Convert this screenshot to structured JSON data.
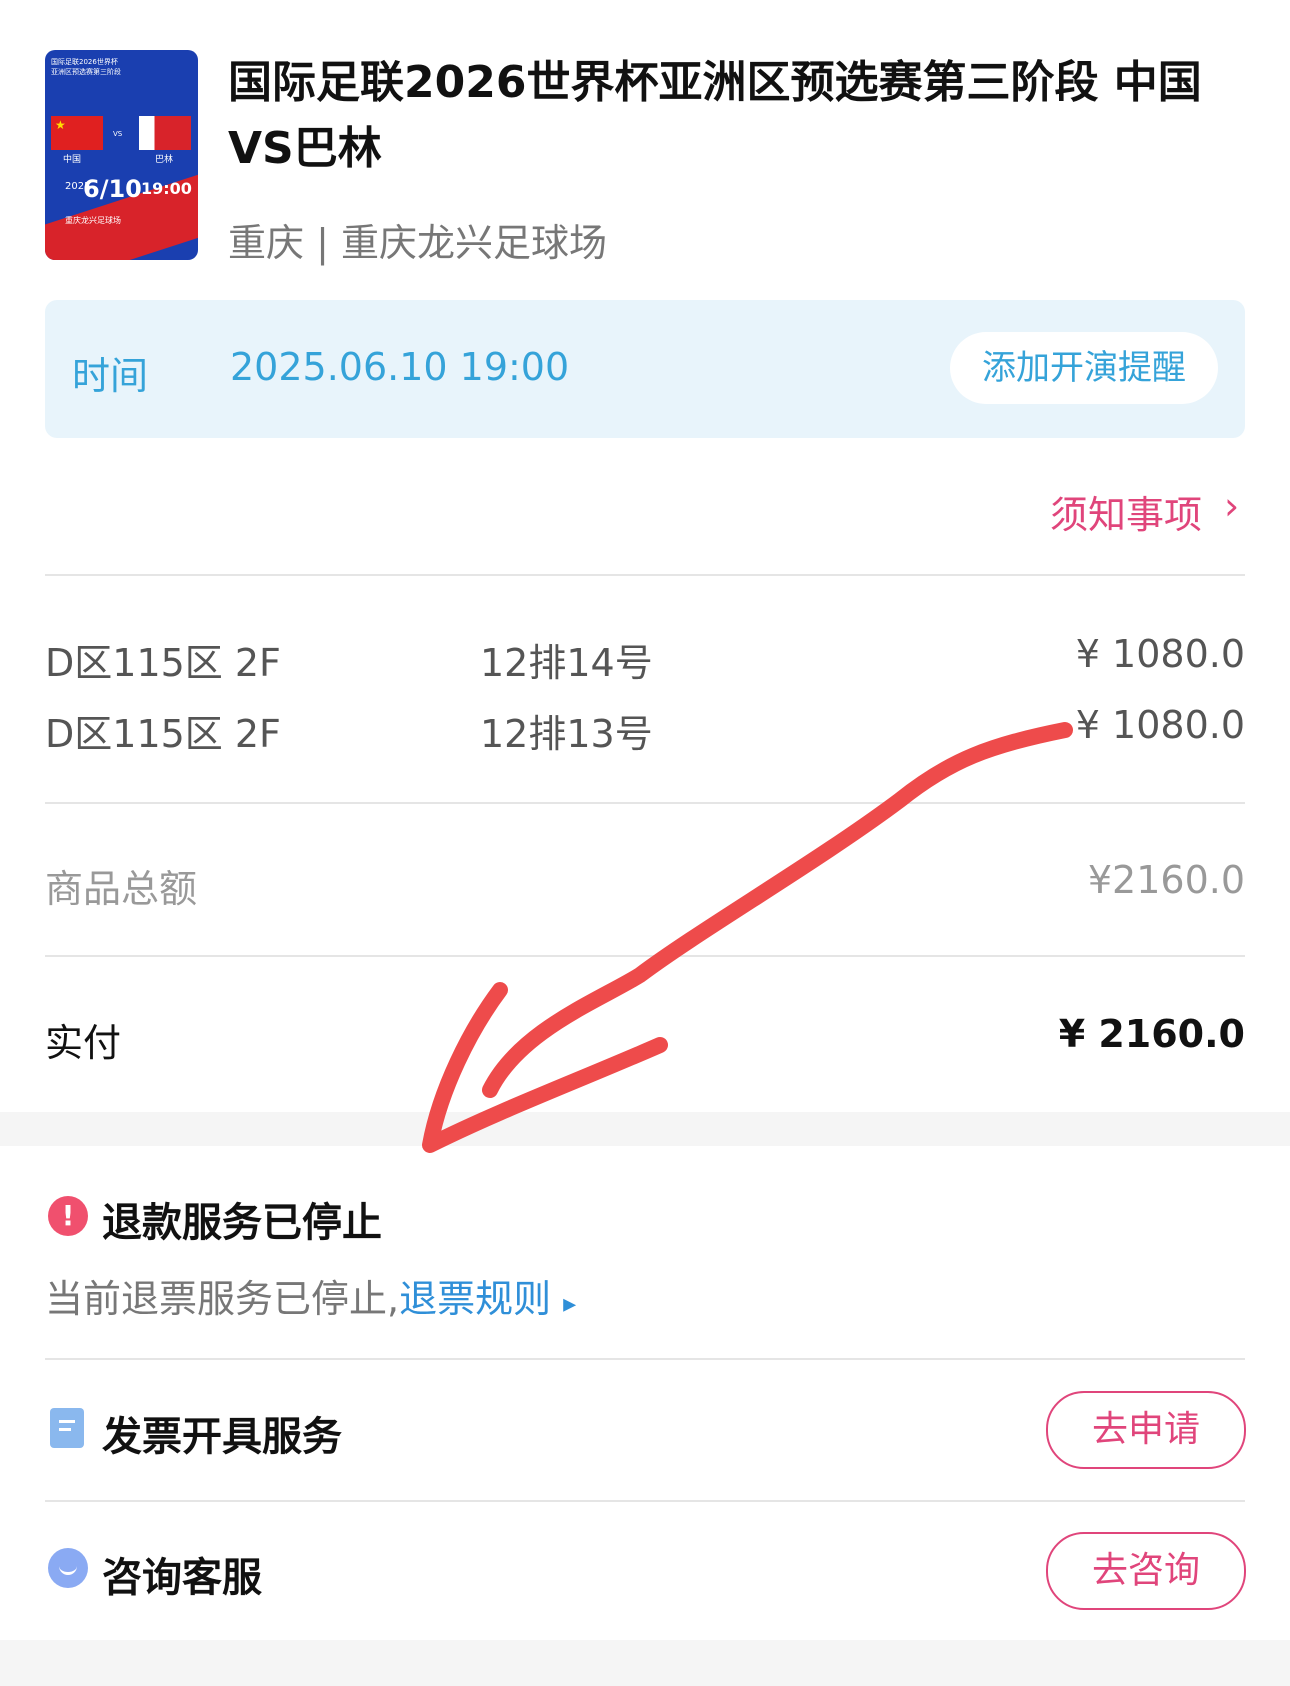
{
  "event": {
    "title": "国际足联2026世界杯亚洲区预选赛第三阶段 中国VS巴林",
    "venue": "重庆 | 重庆龙兴足球场",
    "poster": {
      "line1": "国际足联2026世界杯",
      "line2": "亚洲区预选赛第三阶段",
      "team_home": "中国",
      "vs": "VS",
      "team_away": "巴林",
      "date": "6/10",
      "year": "2025",
      "time": "19:00",
      "location": "重庆龙兴足球场"
    }
  },
  "time_section": {
    "label": "时间",
    "value": "2025.06.10 19:00",
    "reminder_button": "添加开演提醒"
  },
  "notice_link": "须知事项",
  "tickets": [
    {
      "area": "D区115区 2F",
      "seat": "12排14号",
      "price": "¥ 1080.0"
    },
    {
      "area": "D区115区 2F",
      "seat": "12排13号",
      "price": "¥ 1080.0"
    }
  ],
  "summary": {
    "subtotal_label": "商品总额",
    "subtotal_value": "¥2160.0",
    "paid_label": "实付",
    "paid_value": "¥ 2160.0"
  },
  "refund": {
    "title": "退款服务已停止",
    "description": "当前退票服务已停止,",
    "rules_link": "退票规则"
  },
  "invoice": {
    "label": "发票开具服务",
    "button": "去申请"
  },
  "support": {
    "label": "咨询客服",
    "button": "去咨询"
  },
  "colors": {
    "accent_pink": "#e0457b",
    "accent_blue": "#35a3d9",
    "warning_red": "#f0506e",
    "arrow_red": "#ee4b4b"
  }
}
